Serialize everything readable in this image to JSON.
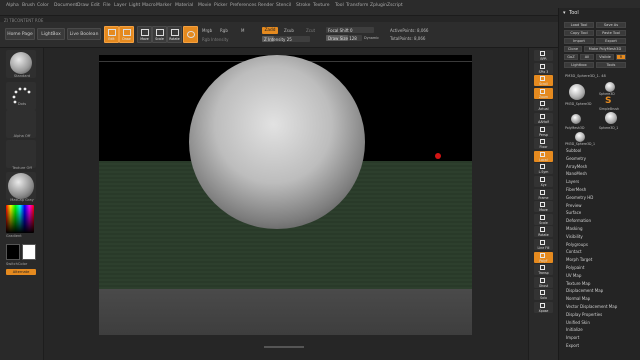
{
  "menubar": {
    "items": [
      "Alpha",
      "Brush",
      "Color",
      "Document",
      "Draw",
      "Edit",
      "File",
      "Layer",
      "Light",
      "Macro",
      "Marker",
      "Material",
      "Movie",
      "Picker",
      "Preferences",
      "Render",
      "Stencil",
      "Stroke",
      "Texture",
      "Tool",
      "Transform",
      "Zplugin",
      "Zscript"
    ],
    "status": "ZI TBCONTENT ROE"
  },
  "toolbar": {
    "home_page": "Home Page",
    "lightbox": "LightBox",
    "live_boolean": "Live Boolean",
    "tool_tiles": [
      {
        "label": "Edit",
        "orange": true
      },
      {
        "label": "Draw",
        "orange": true
      },
      {
        "label": "Move",
        "orange": false
      },
      {
        "label": "Scale",
        "orange": false
      },
      {
        "label": "Rotate",
        "orange": false
      },
      {
        "label": "",
        "orange": true
      }
    ],
    "mrgb": "Mrgb",
    "rgb": "Rgb",
    "m": "M",
    "zadd": "Zadd",
    "zsub": "Zsub",
    "zcut": "Zcut",
    "rgb_intensity": "Rgb Intensity",
    "z_intensity": "Z Intensity 25",
    "focal_shift": "Focal Shift 0",
    "draw_size": "Draw Size 128",
    "dynamic": "Dynamic",
    "active_points": "ActivePoints: 8,066",
    "total_points": "TotalPoints: 8,066"
  },
  "left_shelf": {
    "standard": "Standard",
    "dots": "Dots",
    "alpha_off": "Alpha Off",
    "texture_off": "Texture Off",
    "matcap": "MatCap Gray",
    "gradient": "Gradient",
    "switch_color": "SwitchColor",
    "alternate": "Alternate"
  },
  "right_shelf": {
    "buttons": [
      "BPR",
      "SPix 3",
      "Scroll",
      "Zoom",
      "Actual",
      "AAHalf",
      "Persp",
      "Floor",
      "Local",
      "L.Sym",
      "Xyz",
      "Frame",
      "Move",
      "Scale",
      "Rotate",
      "Line Fill",
      "PolyF",
      "Transp",
      "Ghost",
      "Solo",
      "Xpose"
    ]
  },
  "palette": {
    "title": "Tool",
    "buttons": [
      "Load Tool",
      "Save As",
      "Copy Tool",
      "Paste Tool",
      "Import",
      "Export",
      "Clone",
      "Make PolyMesh3D",
      "GoZ",
      "All",
      "Visible",
      "R",
      "Lightbox",
      "Tools"
    ],
    "current_tool": "PM3D_Sphere3D_1. 48",
    "thumbs": [
      "PM3D_Sphere3D",
      "Sphere3D",
      "SimpleBrush",
      "PolyMesh3D",
      "Sphere3D_1",
      "PM3D_Sphere3D_1"
    ],
    "subtools": [
      "Subtool",
      "Geometry",
      "ArrayMesh",
      "NanoMesh",
      "Layers",
      "FiberMesh",
      "Geometry HD",
      "Preview",
      "Surface",
      "Deformation",
      "Masking",
      "Visibility",
      "Polygroups",
      "Contact",
      "Morph Target",
      "Polypaint",
      "UV Map",
      "Texture Map",
      "Displacement Map",
      "Normal Map",
      "Vector Displacement Map",
      "Display Properties",
      "Unified Skin",
      "Initialize",
      "Import",
      "Export"
    ]
  },
  "colors": {
    "accent": "#e58a1f",
    "panel": "#262626",
    "viewport": "#000000",
    "floor": "#2d3f2d",
    "cursor": "#d21414"
  }
}
